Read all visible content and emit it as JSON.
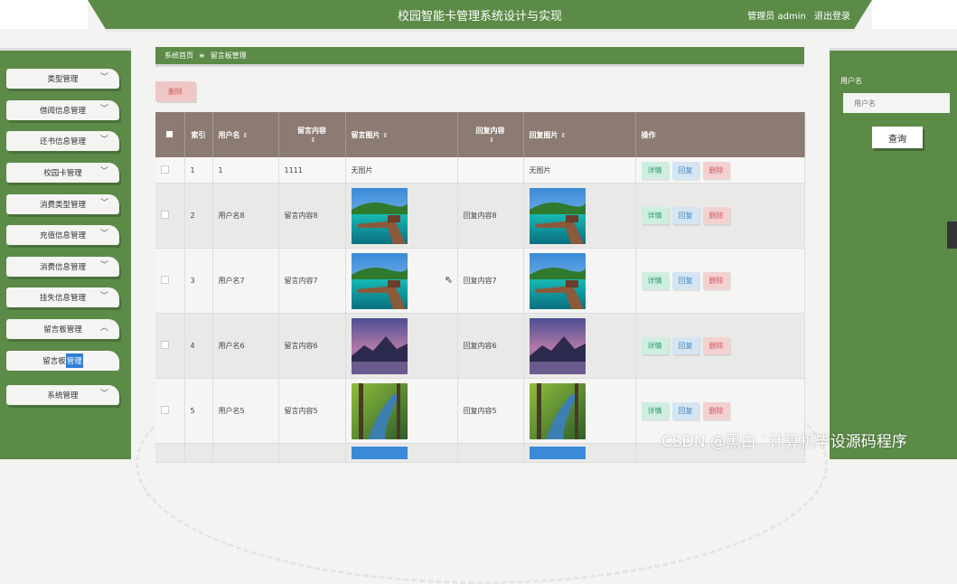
{
  "header": {
    "title": "校园智能卡管理系统设计与实现",
    "user_label": "管理员 admin",
    "logout": "退出登录"
  },
  "sidebar": {
    "items": [
      {
        "label": "类型管理"
      },
      {
        "label": "借阅信息管理"
      },
      {
        "label": "还书信息管理"
      },
      {
        "label": "校园卡管理"
      },
      {
        "label": "消费类型管理"
      },
      {
        "label": "充值信息管理"
      },
      {
        "label": "消费信息管理"
      },
      {
        "label": "挂失信息管理"
      },
      {
        "label": "留言板管理"
      },
      {
        "label": "系统管理"
      }
    ],
    "subitem": {
      "label_prefix": "留言板",
      "label_highlight": "管理"
    }
  },
  "breadcrumb": {
    "home": "系统首页",
    "sep": "≡",
    "current": "留言板管理"
  },
  "toolbar": {
    "delete_label": "删除"
  },
  "table": {
    "headers": {
      "index": "索引",
      "username": "用户名",
      "content": "留言内容",
      "image": "留言图片",
      "reply": "回复内容",
      "reply_image": "回复图片",
      "ops": "操作"
    },
    "rows": [
      {
        "index": "1",
        "username": "1",
        "content": "1111",
        "image_text": "无图片",
        "reply": "",
        "reply_image_text": "无图片",
        "image": null
      },
      {
        "index": "2",
        "username": "用户名8",
        "content": "留言内容8",
        "reply": "回复内容8",
        "image": "pier"
      },
      {
        "index": "3",
        "username": "用户名7",
        "content": "留言内容7",
        "reply": "回复内容7",
        "image": "pier"
      },
      {
        "index": "4",
        "username": "用户名6",
        "content": "留言内容6",
        "reply": "回复内容6",
        "image": "purple-mountain"
      },
      {
        "index": "5",
        "username": "用户名5",
        "content": "留言内容5",
        "reply": "回复内容5",
        "image": "forest-river"
      }
    ],
    "ops": {
      "detail": "详情",
      "reply": "回复",
      "delete": "删除"
    }
  },
  "search": {
    "label": "用户名",
    "placeholder": "用户名",
    "button": "查询"
  },
  "watermark": "CSDN @黑白 `计算机毕设源码程序",
  "colors": {
    "primary_green": "#5c8a47",
    "table_header": "#8c7b72",
    "detail_btn": "#cdeee0",
    "reply_btn": "#d4e5f3",
    "delete_btn": "#f4d1d1"
  }
}
